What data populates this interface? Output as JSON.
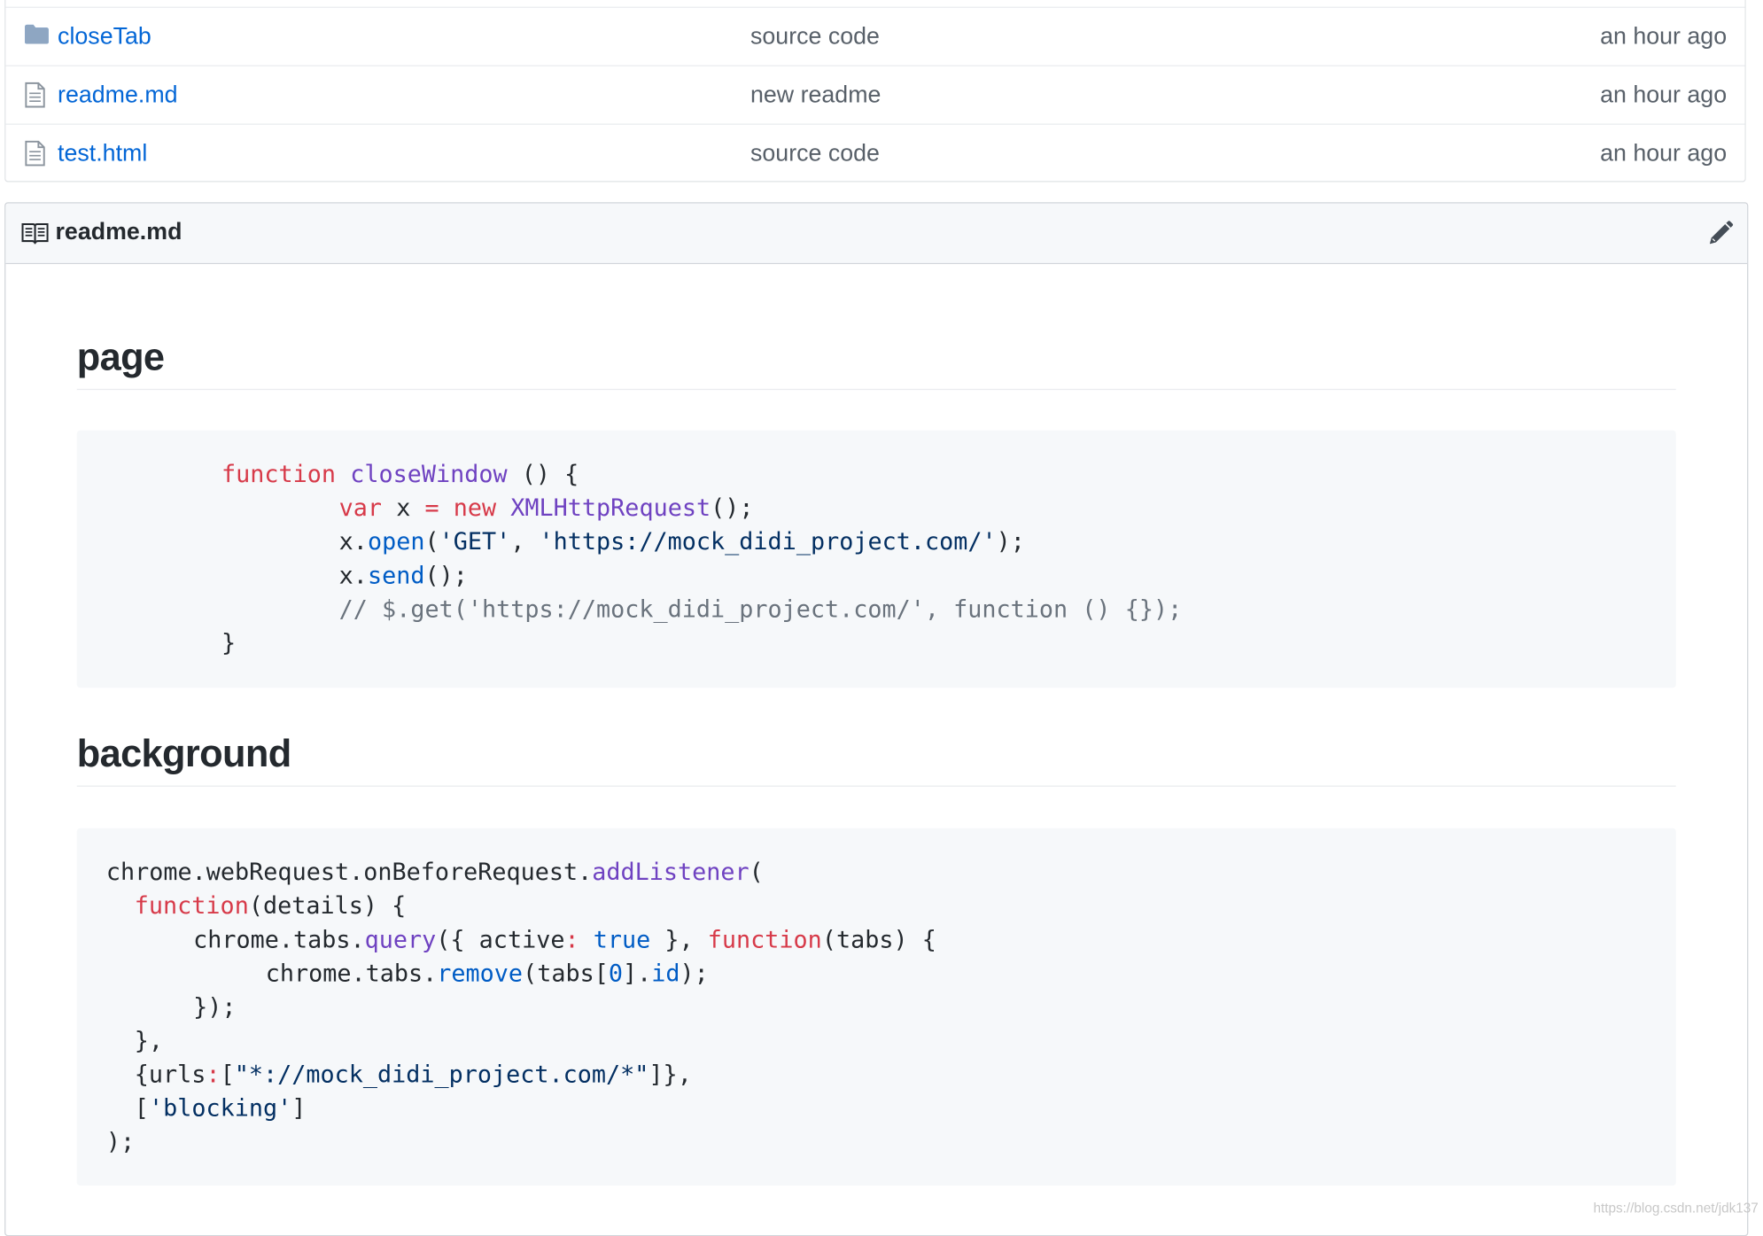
{
  "files": [
    {
      "name": "closeTab",
      "type": "folder",
      "message": "source code",
      "age": "an hour ago"
    },
    {
      "name": "readme.md",
      "type": "file",
      "message": "new readme",
      "age": "an hour ago"
    },
    {
      "name": "test.html",
      "type": "file",
      "message": "source code",
      "age": "an hour ago"
    }
  ],
  "readme": {
    "title": "readme.md",
    "section_page": {
      "heading": "page",
      "code": [
        [
          "function",
          "closeWindow",
          " () {"
        ],
        [
          "var",
          " x ",
          "=",
          " ",
          "new",
          " ",
          "XMLHttpRequest",
          "();"
        ],
        [
          "x.",
          "open",
          "(",
          "'GET'",
          ", ",
          "'https://mock_didi_project.com/'",
          ");"
        ],
        [
          "x.",
          "send",
          "();"
        ],
        [
          "// $.get('https://mock_didi_project.com/', function () {});"
        ],
        [
          "}"
        ]
      ]
    },
    "section_background": {
      "heading": "background",
      "code": [
        [
          "chrome.webRequest.onBeforeRequest.",
          "addListener",
          "("
        ],
        [
          "function",
          "(details) {"
        ],
        [
          "chrome.tabs.",
          "query",
          "({ active",
          ":",
          " ",
          "true",
          " }, ",
          "function",
          "(tabs) {"
        ],
        [
          "chrome.tabs.",
          "remove",
          "(tabs[",
          "0",
          "].",
          "id",
          ");"
        ],
        [
          "});"
        ],
        [
          "},"
        ],
        [
          "{urls",
          ":",
          "[",
          "\"*://mock_didi_project.com/*\"",
          "]},"
        ],
        [
          "[",
          "'blocking'",
          "]"
        ],
        [
          ");"
        ]
      ]
    }
  },
  "watermark": "https://blog.csdn.net/jdk137"
}
